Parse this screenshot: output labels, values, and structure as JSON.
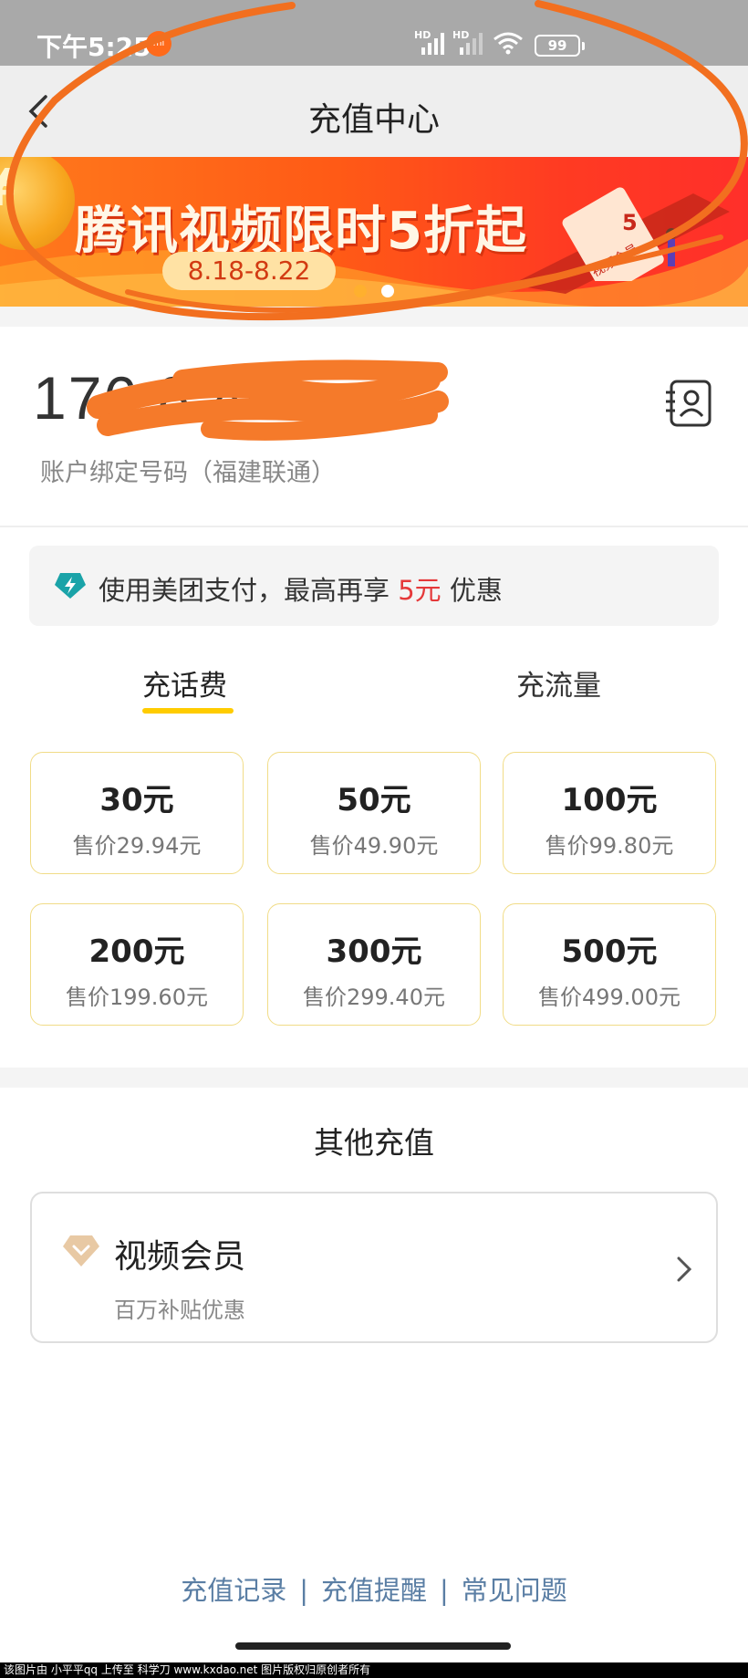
{
  "status_bar": {
    "time": "下午5:25",
    "network_1": "HD",
    "network_2": "HD",
    "battery": "99"
  },
  "header": {
    "title": "充值中心"
  },
  "banner": {
    "coin_symbol": "¥",
    "title": "腾讯视频限时5折起",
    "date_range": "8.18-8.22",
    "ticket_text": "视频会员",
    "ticket_discount": "5"
  },
  "account": {
    "phone_number": "176 8          40",
    "binding_label": "账户绑定号码（福建联通）"
  },
  "promo": {
    "text_prefix": "使用美团支付，最高再享",
    "amount": "5元",
    "text_suffix": "优惠"
  },
  "tabs": [
    {
      "label": "充话费",
      "active": true
    },
    {
      "label": "充流量",
      "active": false
    }
  ],
  "recharge_options": [
    {
      "face": "30元",
      "price": "售价29.94元"
    },
    {
      "face": "50元",
      "price": "售价49.90元"
    },
    {
      "face": "100元",
      "price": "售价99.80元"
    },
    {
      "face": "200元",
      "price": "售价199.60元"
    },
    {
      "face": "300元",
      "price": "售价299.40元"
    },
    {
      "face": "500元",
      "price": "售价499.00元"
    }
  ],
  "other": {
    "title": "其他充值",
    "video_member_title": "视频会员",
    "video_member_sub": "百万补贴优惠"
  },
  "footer": {
    "link_records": "充值记录",
    "link_reminder": "充值提醒",
    "link_faq": "常见问题",
    "separator": "|"
  },
  "watermark": "该图片由 小平平qq 上传至 科学刀 www.kxdao.net 图片版权归原创者所有",
  "colors": {
    "accent_yellow": "#ffcc00",
    "promo_red": "#e5393a",
    "link_blue": "#5a7ea4",
    "scribble_orange": "#f26f1f"
  }
}
